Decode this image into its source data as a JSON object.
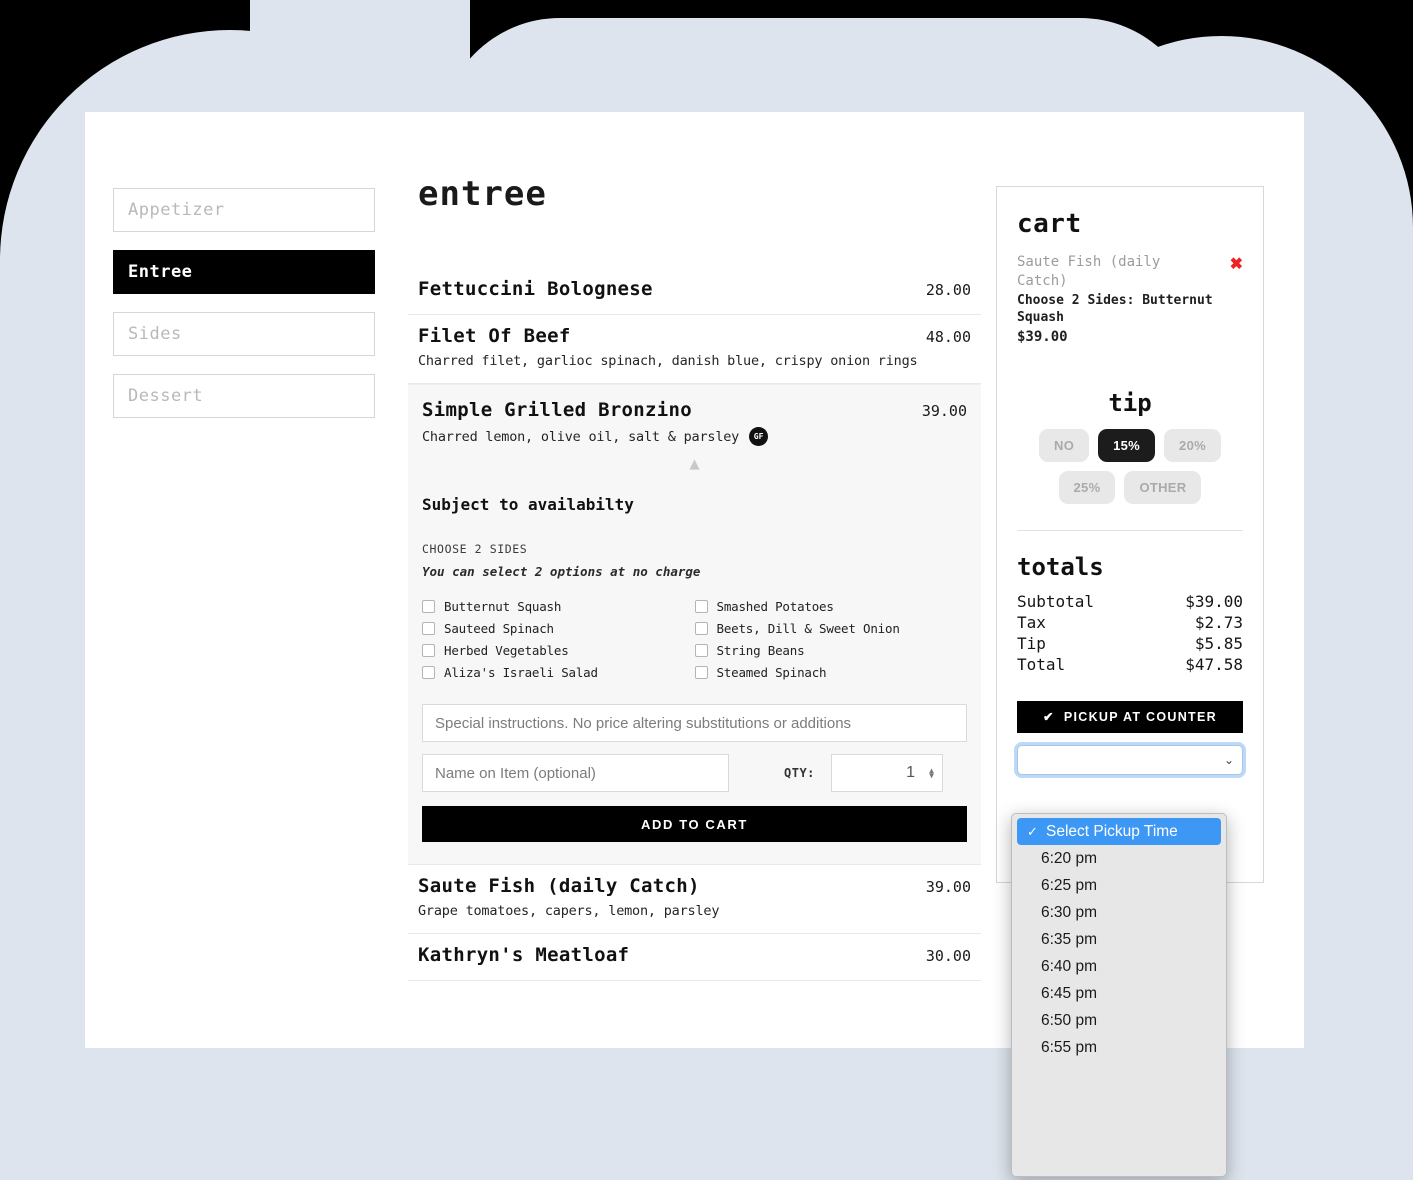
{
  "sidebar": {
    "items": [
      {
        "label": "Appetizer",
        "active": false
      },
      {
        "label": "Entree",
        "active": true
      },
      {
        "label": "Sides",
        "active": false
      },
      {
        "label": "Dessert",
        "active": false
      }
    ]
  },
  "menu": {
    "title": "entree",
    "items": [
      {
        "name": "Fettuccini Bolognese",
        "price": "28.00",
        "desc": ""
      },
      {
        "name": "Filet Of Beef",
        "price": "48.00",
        "desc": "Charred filet, garlioc spinach, danish blue, crispy onion rings"
      },
      {
        "name": "Simple Grilled Bronzino",
        "price": "39.00",
        "desc": "Charred lemon, olive oil, salt & parsley",
        "badge": "GF"
      },
      {
        "name": "Saute Fish (daily Catch)",
        "price": "39.00",
        "desc": "Grape tomatoes, capers, lemon, parsley"
      },
      {
        "name": "Kathryn's Meatloaf",
        "price": "30.00",
        "desc": ""
      }
    ]
  },
  "expanded": {
    "availability_note": "Subject to availabilty",
    "choose_label": "CHOOSE 2 SIDES",
    "choose_hint": "You can select 2 options at no charge",
    "options": [
      {
        "label": "Butternut Squash",
        "checked": false
      },
      {
        "label": "Smashed Potatoes",
        "checked": false
      },
      {
        "label": "Sauteed Spinach",
        "checked": false
      },
      {
        "label": "Beets, Dill & Sweet Onion",
        "checked": false
      },
      {
        "label": "Herbed Vegetables",
        "checked": false
      },
      {
        "label": "String Beans",
        "checked": false
      },
      {
        "label": "Aliza's Israeli Salad",
        "checked": false
      },
      {
        "label": "Steamed Spinach",
        "checked": false
      }
    ],
    "special_placeholder": "Special instructions. No price altering substitutions or additions",
    "special_value": "",
    "name_placeholder": "Name on Item (optional)",
    "name_value": "",
    "qty_label": "QTY:",
    "qty_value": "1",
    "add_to_cart": "ADD TO CART",
    "collapse_icon": "chevron-up"
  },
  "cart": {
    "title": "cart",
    "item": {
      "name": "Saute Fish (daily Catch)",
      "sides": "Choose 2 Sides: Butternut Squash",
      "price": "$39.00",
      "remove_icon": "✖"
    },
    "tip": {
      "title": "tip",
      "options": [
        {
          "label": "NO",
          "selected": false
        },
        {
          "label": "15%",
          "selected": true
        },
        {
          "label": "20%",
          "selected": false
        },
        {
          "label": "25%",
          "selected": false
        },
        {
          "label": "OTHER",
          "selected": false
        }
      ]
    },
    "totals": {
      "title": "totals",
      "rows": [
        {
          "label": "Subtotal",
          "value": "$39.00"
        },
        {
          "label": "Tax",
          "value": "$2.73"
        },
        {
          "label": "Tip",
          "value": "$5.85"
        },
        {
          "label": "Total",
          "value": "$47.58"
        }
      ]
    },
    "pickup_button": "PICKUP AT COUNTER",
    "pickup_check": "✔",
    "select_value": "Select Pickup Time"
  },
  "dropdown": {
    "open": true,
    "options": [
      {
        "label": "Select Pickup Time",
        "selected": true
      },
      {
        "label": "6:20 pm",
        "selected": false
      },
      {
        "label": "6:25 pm",
        "selected": false
      },
      {
        "label": "6:30 pm",
        "selected": false
      },
      {
        "label": "6:35 pm",
        "selected": false
      },
      {
        "label": "6:40 pm",
        "selected": false
      },
      {
        "label": "6:45 pm",
        "selected": false
      },
      {
        "label": "6:50 pm",
        "selected": false
      },
      {
        "label": "6:55 pm",
        "selected": false
      }
    ],
    "check_glyph": "✓"
  },
  "colors": {
    "backdrop": "#dde4ed",
    "accent_dark": "#000000",
    "remove_red": "#ee2222",
    "highlight_blue": "#3d97f5",
    "focus_ring": "#bcd9f7"
  }
}
